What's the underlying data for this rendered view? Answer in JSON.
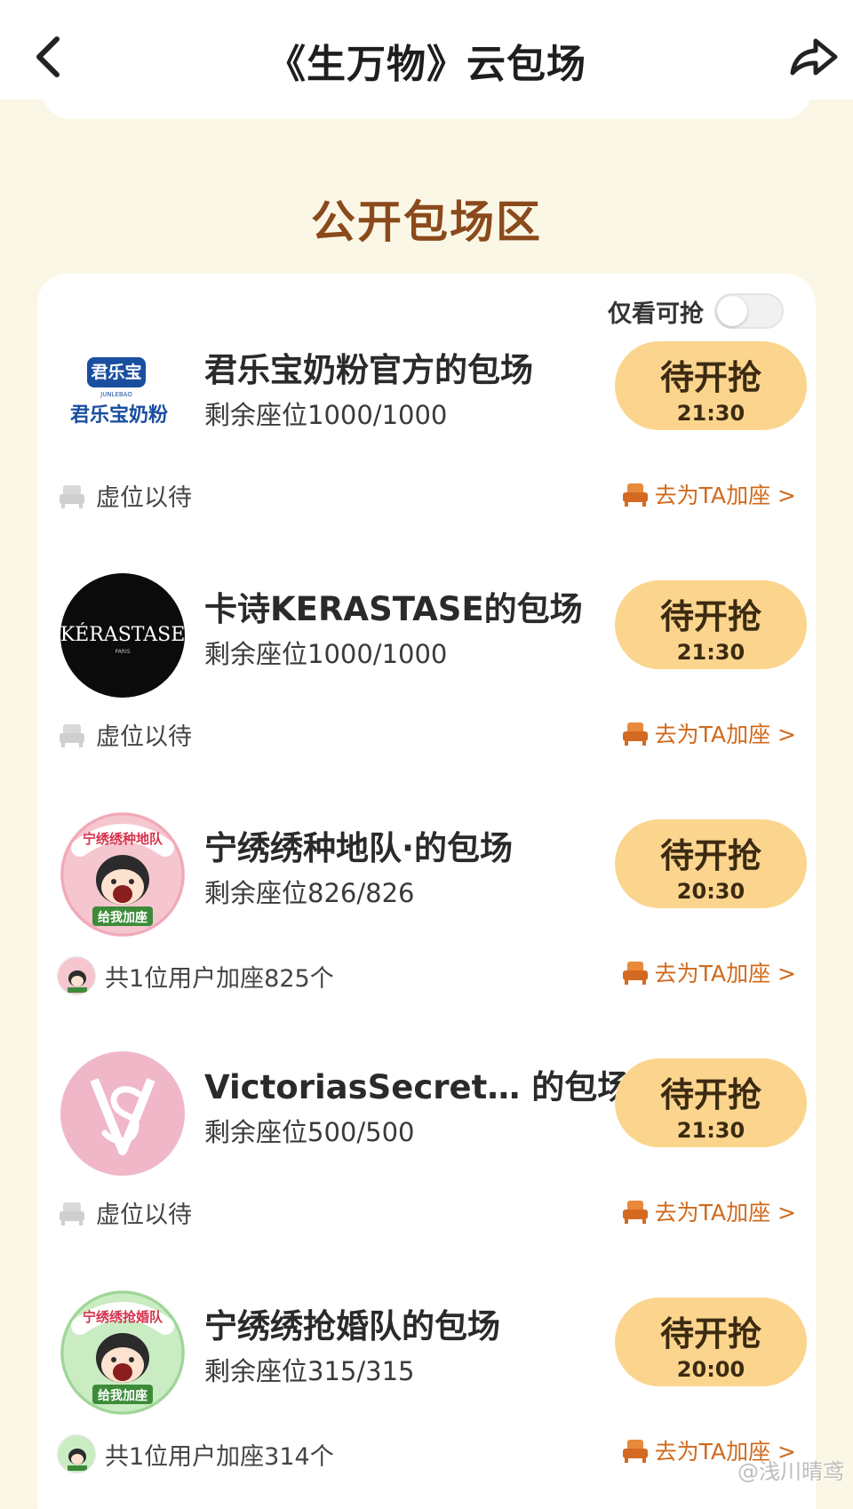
{
  "header": {
    "title": "《生万物》云包场",
    "back_icon": "chevron-left-icon",
    "share_icon": "share-arrow-icon"
  },
  "section": {
    "title": "公开包场区"
  },
  "filter": {
    "label": "仅看可抢",
    "toggle_on": false
  },
  "items": [
    {
      "name": "君乐宝奶粉官方的包场",
      "seats": "剩余座位1000/1000",
      "button_label": "待开抢",
      "time": "21:30",
      "footer_text": "虚位以待",
      "add_seat": "去为TA加座 >",
      "logo_text_top": "君乐宝",
      "logo_text_sub": "JUNLEBAO",
      "logo_text_bottom": "君乐宝奶粉"
    },
    {
      "name": "卡诗KERASTASE的包场",
      "seats": "剩余座位1000/1000",
      "button_label": "待开抢",
      "time": "21:30",
      "footer_text": "虚位以待",
      "add_seat": "去为TA加座 >",
      "logo_text": "KÉRASTASE",
      "logo_sub": "PARIS"
    },
    {
      "name": "宁绣绣种地队·的包场",
      "seats": "剩余座位826/826",
      "button_label": "待开抢",
      "time": "20:30",
      "footer_text": "共1位用户加座825个",
      "add_seat": "去为TA加座 >",
      "badge_top": "宁绣绣种地队",
      "badge_bottom": "给我加座"
    },
    {
      "name": "VictoriasSecret… 的包场",
      "seats": "剩余座位500/500",
      "button_label": "待开抢",
      "time": "21:30",
      "footer_text": "虚位以待",
      "add_seat": "去为TA加座 >"
    },
    {
      "name": "宁绣绣抢婚队的包场",
      "seats": "剩余座位315/315",
      "button_label": "待开抢",
      "time": "20:00",
      "footer_text": "共1位用户加座314个",
      "add_seat": "去为TA加座 >",
      "badge_top": "宁绣绣抢婚队",
      "badge_bottom": "给我加座"
    }
  ],
  "watermark": "@浅川晴鸢",
  "colors": {
    "page_bg": "#fbf7e6",
    "section_title": "#8b4a1c",
    "button_bg": "#fbd58d",
    "link_orange": "#d06a1c"
  }
}
